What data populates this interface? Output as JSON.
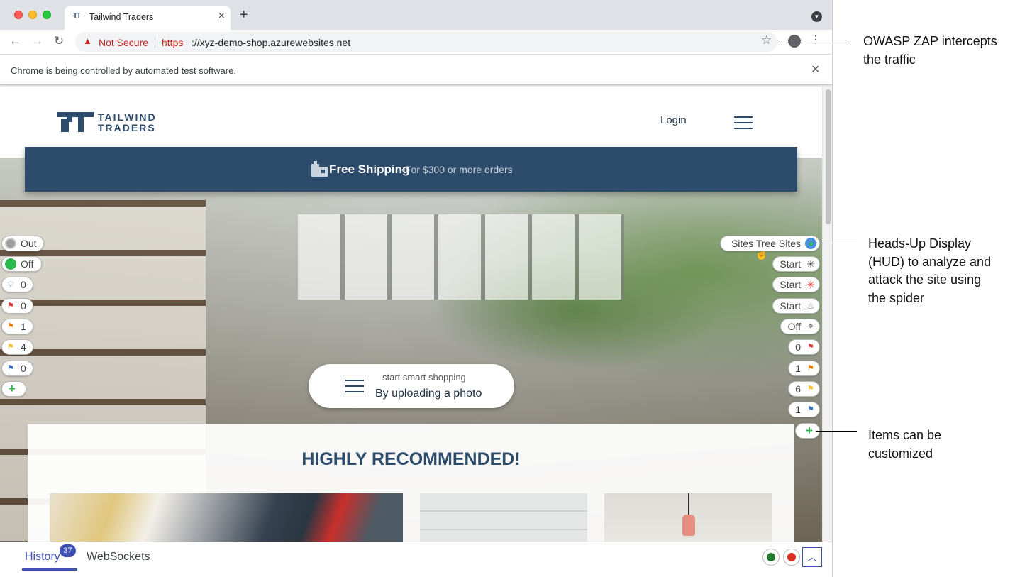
{
  "browser": {
    "tab_title": "Tailwind Traders",
    "tab_favicon_text": "TT",
    "not_secure_label": "Not Secure",
    "url_scheme": "https",
    "url_rest": "://xyz-demo-shop.azurewebsites.net",
    "infobar_text": "Chrome is being controlled by automated test software."
  },
  "site": {
    "logo_line1": "TAILWIND",
    "logo_line2": "TRADERS",
    "login_label": "Login",
    "banner_bold": "Free Shipping",
    "banner_light": "•For $300 or more orders",
    "upload_line1": "start smart shopping",
    "upload_line2": "By uploading a photo",
    "reco_title": "HIGHLY RECOMMENDED!"
  },
  "hud_left": [
    {
      "label": "Out",
      "icon": "target-icon"
    },
    {
      "label": "Off",
      "icon": "green-circle-icon"
    },
    {
      "label": "0",
      "icon": "lightbulb-icon"
    },
    {
      "label": "0",
      "icon": "red-flag-icon"
    },
    {
      "label": "1",
      "icon": "orange-flag-icon"
    },
    {
      "label": "4",
      "icon": "yellow-flag-icon"
    },
    {
      "label": "0",
      "icon": "blue-flag-icon"
    },
    {
      "label": "",
      "icon": "plus-icon"
    }
  ],
  "hud_right": [
    {
      "label": "Sites Tree   Sites",
      "icon": "globe-icon"
    },
    {
      "label": "Start",
      "icon": "spider-icon"
    },
    {
      "label": "Start",
      "icon": "ajax-spider-icon"
    },
    {
      "label": "Start",
      "icon": "flame-icon"
    },
    {
      "label": "Off",
      "icon": "crosshair-icon"
    },
    {
      "label": "0",
      "icon": "red-flag-icon"
    },
    {
      "label": "1",
      "icon": "orange-flag-icon"
    },
    {
      "label": "6",
      "icon": "yellow-flag-icon"
    },
    {
      "label": "1",
      "icon": "blue-flag-icon"
    },
    {
      "label": "",
      "icon": "plus-icon"
    }
  ],
  "bottom": {
    "history_label": "History",
    "history_count": "37",
    "websockets_label": "WebSockets"
  },
  "annotations": {
    "ann1_line1": "OWASP ZAP intercepts",
    "ann1_line2": "the traffic",
    "ann2_line1": "Heads-Up Display",
    "ann2_line2": "(HUD) to analyze and",
    "ann2_line3": "attack the site using",
    "ann2_line4": "the spider",
    "ann3_line1": "Items can be",
    "ann3_line2": "customized"
  },
  "colors": {
    "brand_navy": "#2d4b6a",
    "hud_accent": "#3f51b5",
    "not_secure_red": "#c5221f"
  }
}
